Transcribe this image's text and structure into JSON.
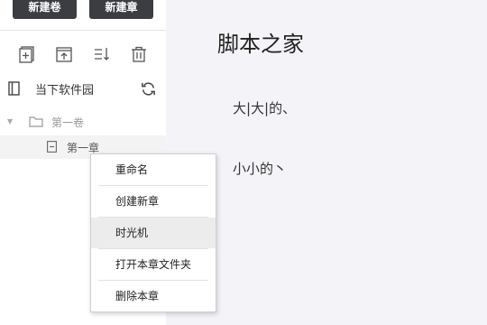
{
  "sidebar": {
    "new_volume_button": "新建卷",
    "new_chapter_button": "新建章",
    "toolbar_icons": [
      "add-file-icon",
      "upload-file-icon",
      "sort-icon",
      "trash-icon"
    ],
    "project": {
      "name": "当下软件园",
      "icons": [
        "book-icon",
        "refresh-icon"
      ]
    },
    "tree": {
      "volume_label": "第一卷",
      "chapter_label": "第一章"
    }
  },
  "editor": {
    "title": "脚本之家",
    "lines": [
      "大|大|的、",
      "小小的丶"
    ]
  },
  "context_menu": {
    "items": [
      "重命名",
      "创建新章",
      "时光机",
      "打开本章文件夹",
      "删除本章"
    ],
    "highlighted_item": "时光机"
  },
  "colors": {
    "button_dark": "#3b3d41",
    "editor_background": "#f4f4f8",
    "menu_highlight": "#ececec"
  }
}
